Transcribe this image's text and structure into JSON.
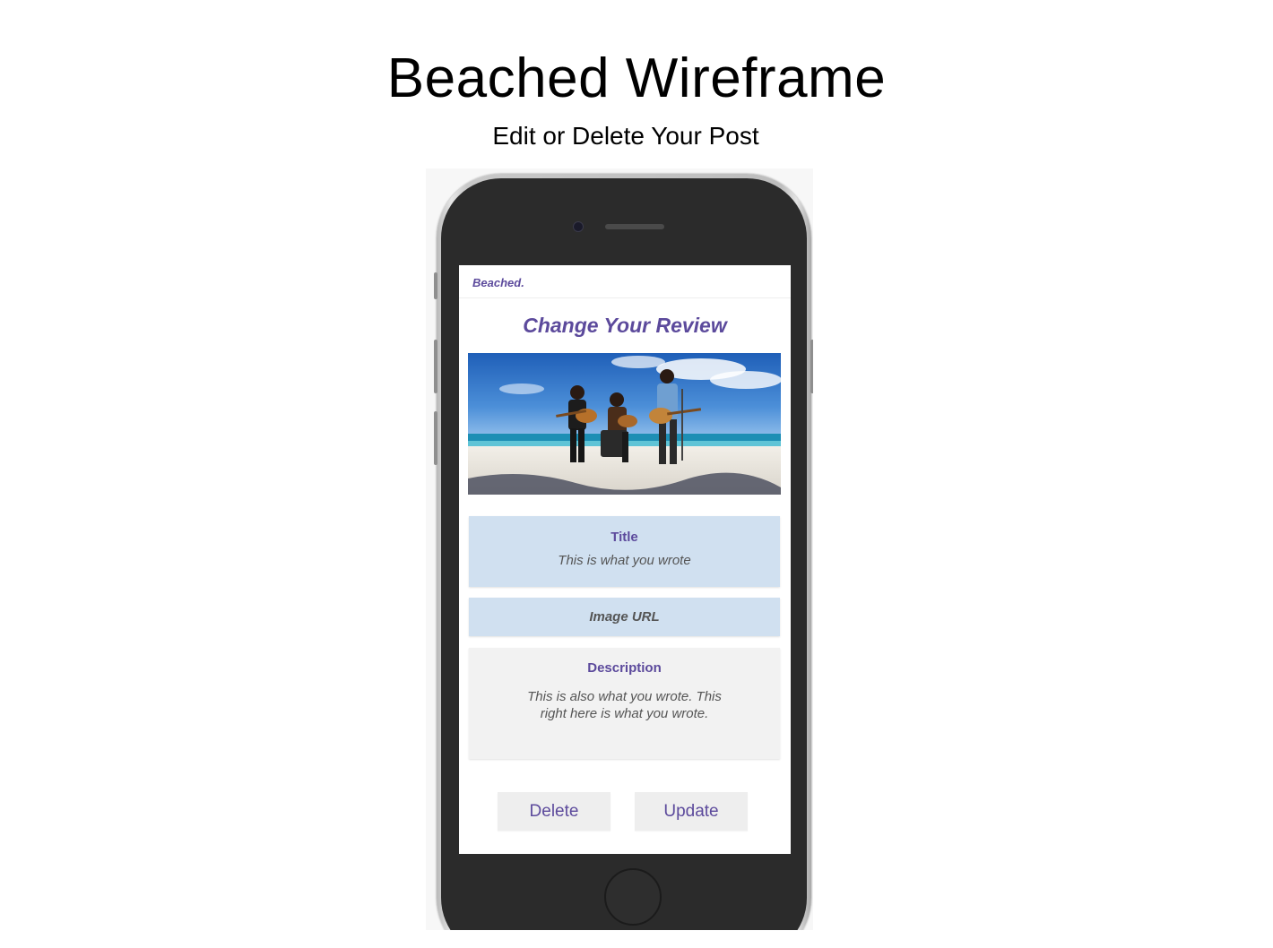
{
  "page": {
    "title": "Beached Wireframe",
    "subtitle": "Edit or Delete Your Post"
  },
  "app": {
    "brand": "Beached.",
    "screen_title": "Change Your Review",
    "hero_image": "beach-musicians-photo",
    "fields": {
      "title": {
        "label": "Title",
        "value": "This is what you wrote"
      },
      "image_url": {
        "placeholder": "Image URL"
      },
      "description": {
        "label": "Description",
        "value_line1": "This is also what you wrote. This",
        "value_line2": "right here is what you wrote."
      }
    },
    "buttons": {
      "delete_label": "Delete",
      "update_label": "Update"
    }
  },
  "colors": {
    "accent": "#5c4a9c",
    "field_blue": "#d0e0f0",
    "field_grey": "#f2f2f2",
    "phone_body": "#2b2b2b"
  }
}
